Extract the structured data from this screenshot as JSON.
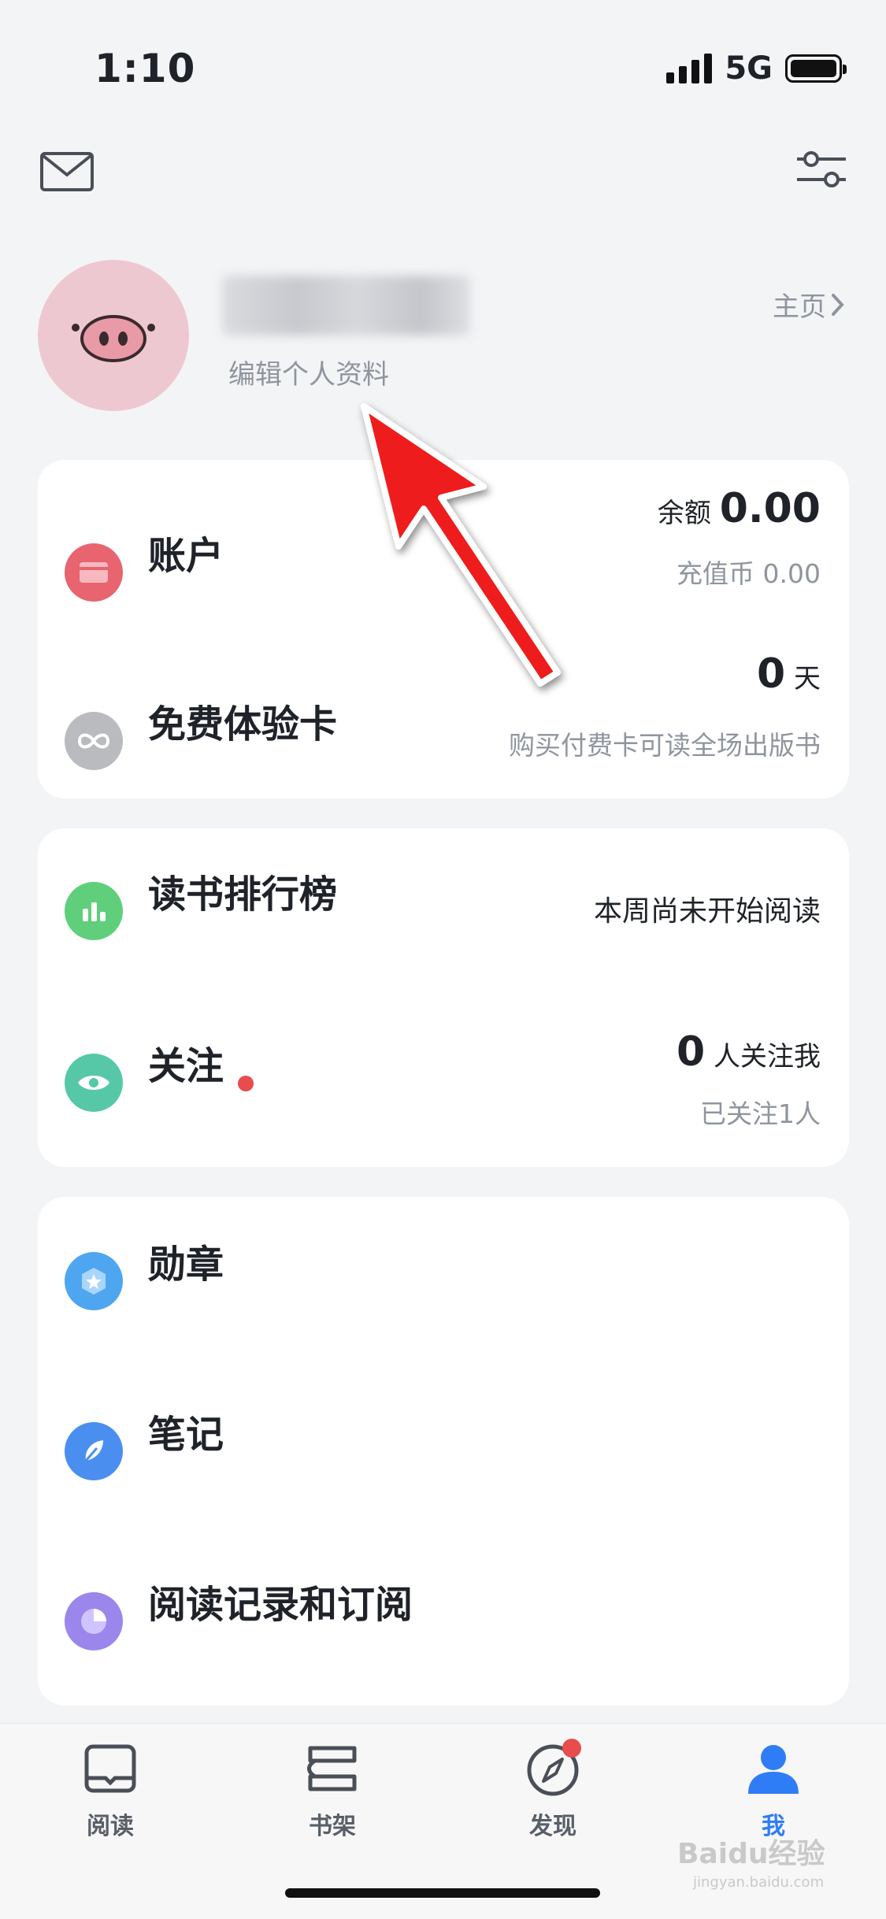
{
  "status_bar": {
    "time": "1:10",
    "network": "5G"
  },
  "header": {
    "left_icon": "mail-icon",
    "right_icon": "settings-sliders-icon"
  },
  "profile": {
    "edit_label": "编辑个人资料",
    "homepage_label": "主页"
  },
  "account_card": {
    "account": {
      "title": "账户",
      "balance_label": "余额",
      "balance_value": "0.00",
      "recharge_label": "充值币 0.00"
    },
    "trial": {
      "title": "免费体验卡",
      "days_value": "0",
      "days_unit": "天",
      "hint": "购买付费卡可读全场出版书"
    }
  },
  "social_card": {
    "ranking": {
      "title": "读书排行榜",
      "status": "本周尚未开始阅读"
    },
    "follow": {
      "title": "关注",
      "followers_value": "0",
      "followers_label": "人关注我",
      "following_label": "已关注1人"
    }
  },
  "misc_card": {
    "items": [
      {
        "title": "勋章",
        "icon": "medal-icon"
      },
      {
        "title": "笔记",
        "icon": "feather-icon"
      },
      {
        "title": "阅读记录和订阅",
        "icon": "clock-pie-icon"
      }
    ]
  },
  "bottom_nav": {
    "items": [
      {
        "label": "阅读",
        "icon": "book-icon"
      },
      {
        "label": "书架",
        "icon": "bookshelf-icon"
      },
      {
        "label": "发现",
        "icon": "compass-icon"
      },
      {
        "label": "我",
        "icon": "person-icon"
      }
    ],
    "active_index": 3
  },
  "watermark": {
    "text": "Baidu经验",
    "sub": "jingyan.baidu.com"
  },
  "colors": {
    "background": "#f3f4f6",
    "card": "#ffffff",
    "accent": "#2f7df6",
    "badge_red": "#e84c4c",
    "arrow_red": "#ee1c1c"
  }
}
